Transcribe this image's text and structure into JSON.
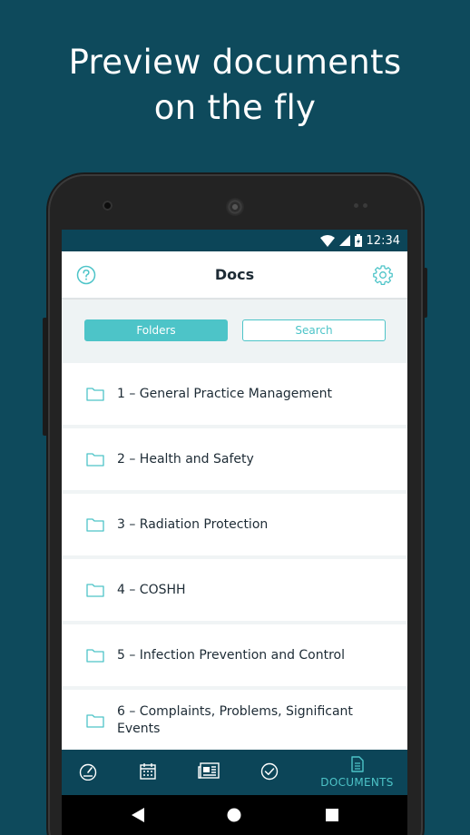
{
  "headline": {
    "line1": "Preview documents",
    "line2": "on the fly"
  },
  "status": {
    "time": "12:34"
  },
  "header": {
    "title": "Docs",
    "help_icon": "help-circle-icon",
    "settings_icon": "gear-icon"
  },
  "segments": {
    "folders": "Folders",
    "search": "Search",
    "active": "Folders"
  },
  "folders": [
    {
      "label": "1 – General Practice Management"
    },
    {
      "label": "2 – Health and Safety"
    },
    {
      "label": "3 – Radiation Protection"
    },
    {
      "label": "4 – COSHH"
    },
    {
      "label": "5 – Infection Prevention and Control"
    },
    {
      "label": "6 – Complaints, Problems, Significant Events"
    }
  ],
  "tabs": [
    {
      "icon": "dashboard-icon"
    },
    {
      "icon": "calendar-icon"
    },
    {
      "icon": "news-icon"
    },
    {
      "icon": "check-circle-icon"
    },
    {
      "icon": "document-icon",
      "label": "DOCUMENTS",
      "active": true
    }
  ],
  "colors": {
    "background": "#0e4a5c",
    "accent": "#4dc4c8",
    "bar": "#0c4558"
  }
}
